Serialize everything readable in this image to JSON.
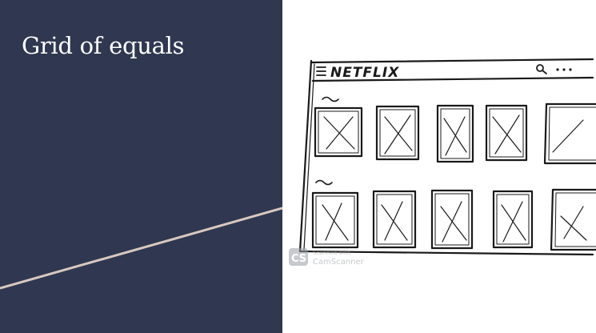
{
  "slide": {
    "title": "Grid of equals",
    "background_color": "#2f3850",
    "accent_line_color": "#d8c8c0"
  },
  "sketch": {
    "app_label": "NETFLIX",
    "watermark_label": "CamScanner",
    "watermark_scanned_label": "Scanned with",
    "watermark_logo_text": "CS",
    "header_icons": [
      "hamburger-icon",
      "search-icon",
      "more-dots-icon"
    ],
    "rows": [
      {
        "tiles": 5
      },
      {
        "tiles": 5
      }
    ]
  }
}
